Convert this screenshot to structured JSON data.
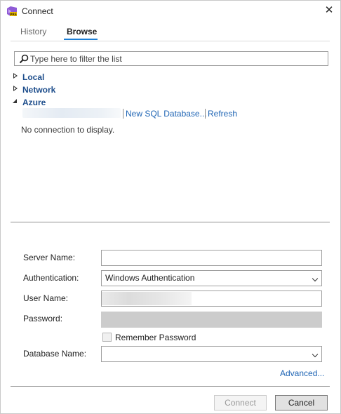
{
  "window": {
    "title": "Connect",
    "close_glyph": "✕",
    "icon": "visual-studio-icon"
  },
  "tabs": [
    {
      "label": "History",
      "active": false
    },
    {
      "label": "Browse",
      "active": true
    }
  ],
  "search": {
    "placeholder": "Type here to filter the list",
    "value": "",
    "icon": "search-icon"
  },
  "tree": {
    "nodes": [
      {
        "label": "Local",
        "expanded": false
      },
      {
        "label": "Network",
        "expanded": false
      },
      {
        "label": "Azure",
        "expanded": true
      }
    ],
    "azure_links": {
      "new_sql": "New SQL Database...",
      "refresh": "Refresh"
    },
    "empty_message": "No connection to display."
  },
  "form": {
    "server_label": "Server Name:",
    "server_value": "",
    "auth_label": "Authentication:",
    "auth_value": "Windows Authentication",
    "user_label": "User Name:",
    "password_label": "Password:",
    "remember_label": "Remember Password",
    "remember_checked": false,
    "database_label": "Database Name:",
    "database_value": "",
    "advanced_link": "Advanced..."
  },
  "buttons": {
    "connect": "Connect",
    "cancel": "Cancel"
  },
  "colors": {
    "accent": "#1c7fd6",
    "link": "#1e64b4",
    "tree_node": "#1e4e8c"
  }
}
